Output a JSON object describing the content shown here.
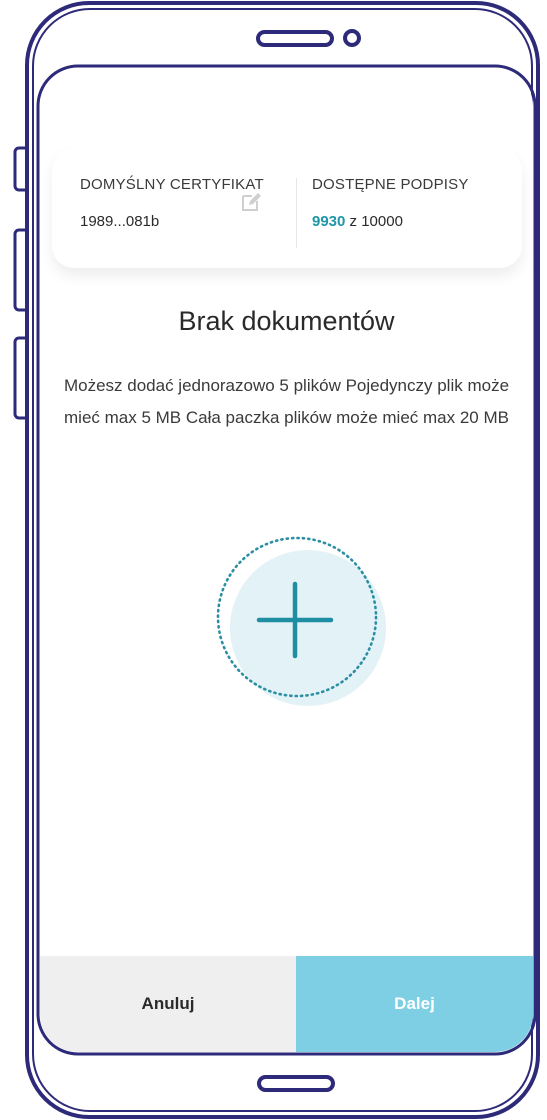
{
  "certificate": {
    "default_label": "DOMYŚLNY CERTYFIKAT",
    "default_value": "1989...081b",
    "signatures_label": "DOSTĘPNE PODPISY",
    "signatures_used": "9930",
    "signatures_total": "z 10000",
    "edit_icon": "pencil-edit-icon"
  },
  "empty_state": {
    "title": "Brak dokumentów",
    "description": "Możesz dodać jednorazowo 5 plików Pojedynczy plik może mieć max 5 MB Cała paczka plików może mieć max 20 MB",
    "add_icon": "plus-icon"
  },
  "footer": {
    "cancel_label": "Anuluj",
    "next_label": "Dalej"
  },
  "colors": {
    "accent": "#1e96a8",
    "next_button": "#7ecfe3",
    "cancel_button": "#efefef",
    "frame": "#2e2a7a"
  }
}
